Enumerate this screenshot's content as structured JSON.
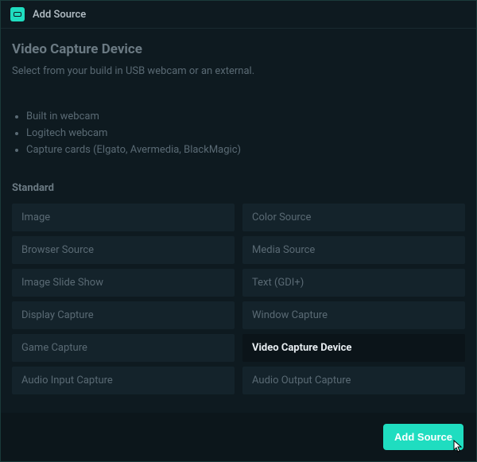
{
  "titlebar": {
    "title": "Add Source"
  },
  "details": {
    "heading": "Video Capture Device",
    "description": "Select from your build in USB webcam or an external.",
    "bullets": [
      "Built in webcam",
      "Logitech webcam",
      "Capture cards (Elgato, Avermedia, BlackMagic)"
    ]
  },
  "section": {
    "label": "Standard"
  },
  "sources": [
    {
      "label": "Image",
      "selected": false
    },
    {
      "label": "Color Source",
      "selected": false
    },
    {
      "label": "Browser Source",
      "selected": false
    },
    {
      "label": "Media Source",
      "selected": false
    },
    {
      "label": "Image Slide Show",
      "selected": false
    },
    {
      "label": "Text (GDI+)",
      "selected": false
    },
    {
      "label": "Display Capture",
      "selected": false
    },
    {
      "label": "Window Capture",
      "selected": false
    },
    {
      "label": "Game Capture",
      "selected": false
    },
    {
      "label": "Video Capture Device",
      "selected": true
    },
    {
      "label": "Audio Input Capture",
      "selected": false
    },
    {
      "label": "Audio Output Capture",
      "selected": false
    }
  ],
  "footer": {
    "button_label": "Add Source"
  }
}
